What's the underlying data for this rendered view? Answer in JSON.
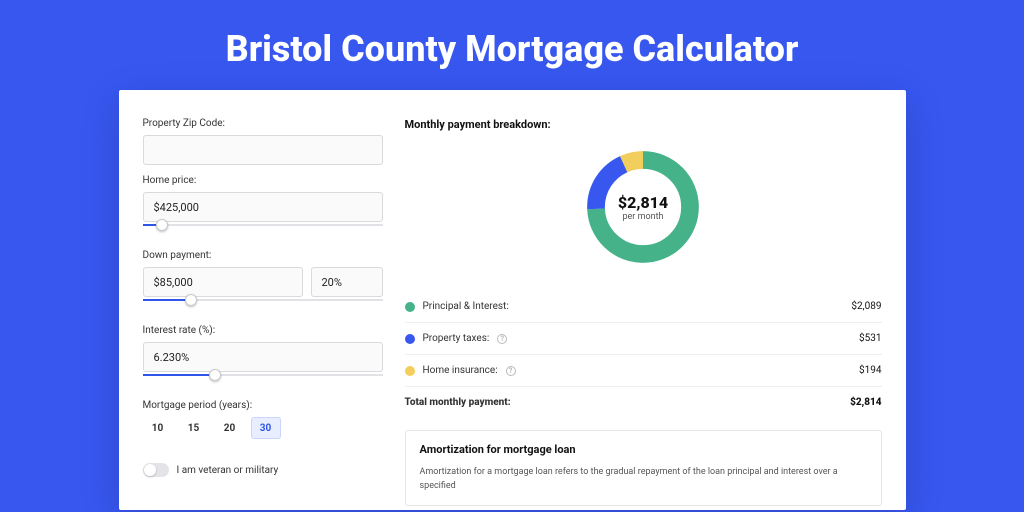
{
  "title": "Bristol County Mortgage Calculator",
  "colors": {
    "primary": "#3757ef",
    "green": "#45b28a",
    "blue": "#3757ef",
    "yellow": "#f2ce5d"
  },
  "form": {
    "zip_label": "Property Zip Code:",
    "zip_value": "",
    "home_price_label": "Home price:",
    "home_price_value": "$425,000",
    "home_price_slider_pct": 8,
    "down_payment_label": "Down payment:",
    "down_payment_value": "$85,000",
    "down_payment_pct": "20%",
    "down_payment_slider_pct": 20,
    "interest_label": "Interest rate (%):",
    "interest_value": "6.230%",
    "interest_slider_pct": 30,
    "period_label": "Mortgage period (years):",
    "period_options": [
      "10",
      "15",
      "20",
      "30"
    ],
    "period_active_index": 3,
    "vet_label": "I am veteran or military",
    "vet_on": false
  },
  "breakdown": {
    "title": "Monthly payment breakdown:",
    "center_amount": "$2,814",
    "center_sub": "per month",
    "rows": [
      {
        "label": "Principal & Interest:",
        "value": "$2,089",
        "color": "green",
        "info": false
      },
      {
        "label": "Property taxes:",
        "value": "$531",
        "color": "blue",
        "info": true
      },
      {
        "label": "Home insurance:",
        "value": "$194",
        "color": "yellow",
        "info": true
      }
    ],
    "total_label": "Total monthly payment:",
    "total_value": "$2,814"
  },
  "amortization": {
    "title": "Amortization for mortgage loan",
    "body": "Amortization for a mortgage loan refers to the gradual repayment of the loan principal and interest over a specified"
  },
  "chart_data": {
    "type": "pie",
    "title": "Monthly payment breakdown",
    "series": [
      {
        "name": "Principal & Interest",
        "value": 2089,
        "color": "#45b28a"
      },
      {
        "name": "Property taxes",
        "value": 531,
        "color": "#3757ef"
      },
      {
        "name": "Home insurance",
        "value": 194,
        "color": "#f2ce5d"
      }
    ],
    "total": 2814
  }
}
